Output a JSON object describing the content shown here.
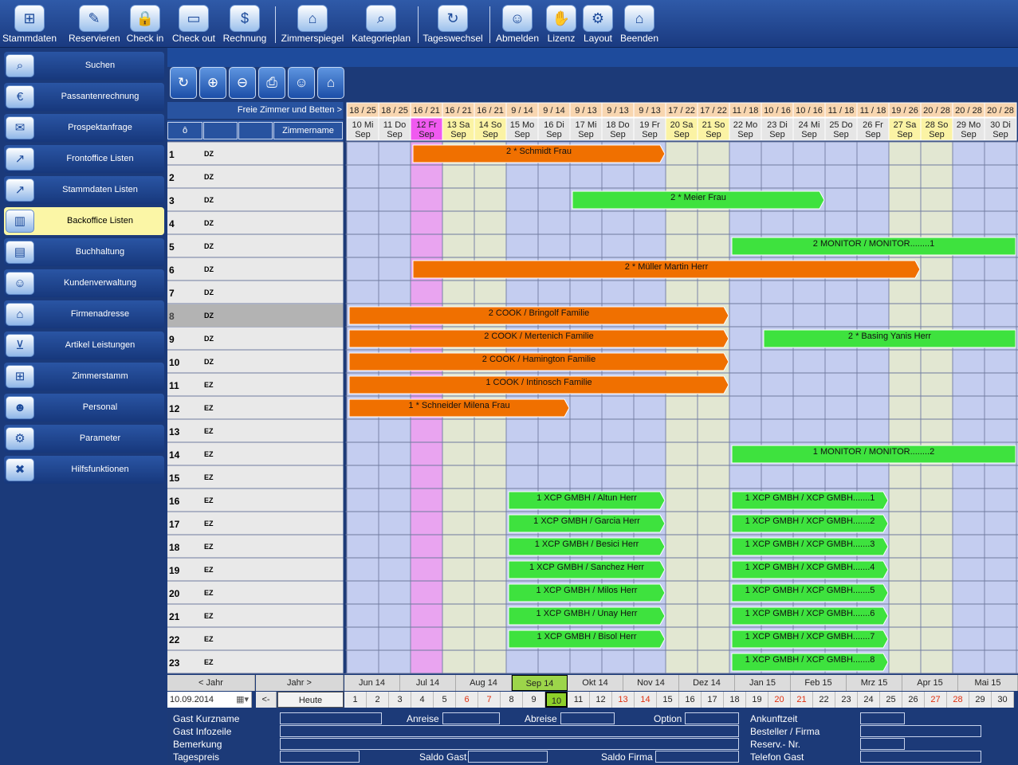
{
  "toolbar": {
    "buttons": [
      {
        "label": "Stammdaten",
        "icon": "org-chart-icon",
        "glyph": "⊞"
      },
      {
        "label": "Reservieren",
        "icon": "pen-document-icon",
        "glyph": "✎"
      },
      {
        "label": "Check in",
        "icon": "lock-icon",
        "glyph": "🔒"
      },
      {
        "label": "Check out",
        "icon": "card-icon",
        "glyph": "▭"
      },
      {
        "label": "Rechnung",
        "icon": "money-bag-icon",
        "glyph": "$"
      },
      {
        "label": "Zimmerspiegel",
        "icon": "house-icon",
        "glyph": "⌂"
      },
      {
        "label": "Kategorieplan",
        "icon": "house-search-icon",
        "glyph": "⌕"
      },
      {
        "label": "Tageswechsel",
        "icon": "refresh-icon",
        "glyph": "↻"
      },
      {
        "label": "Abmelden",
        "icon": "user-icon",
        "glyph": "☺"
      },
      {
        "label": "Lizenz",
        "icon": "handshake-icon",
        "glyph": "✋"
      },
      {
        "label": "Layout",
        "icon": "gear-icon",
        "glyph": "⚙"
      },
      {
        "label": "Beenden",
        "icon": "home-exit-icon",
        "glyph": "⌂"
      }
    ]
  },
  "sidebar": {
    "items": [
      {
        "label": "Suchen",
        "icon": "magnifier-icon",
        "glyph": "⌕"
      },
      {
        "label": "Passantenrechnung",
        "icon": "cash-icon",
        "glyph": "€"
      },
      {
        "label": "Prospektanfrage",
        "icon": "envelope-icon",
        "glyph": "✉"
      },
      {
        "label": "Frontoffice Listen",
        "icon": "line-chart-icon",
        "glyph": "↗"
      },
      {
        "label": "Stammdaten Listen",
        "icon": "line-chart-icon",
        "glyph": "↗"
      },
      {
        "label": "Backoffice Listen",
        "icon": "bar-chart-icon",
        "glyph": "▥",
        "active": true
      },
      {
        "label": "Buchhaltung",
        "icon": "books-icon",
        "glyph": "▤"
      },
      {
        "label": "Kundenverwaltung",
        "icon": "users-icon",
        "glyph": "☺"
      },
      {
        "label": "Firmenadresse",
        "icon": "bank-icon",
        "glyph": "⌂"
      },
      {
        "label": "Artikel Leistungen",
        "icon": "cart-icon",
        "glyph": "⊻"
      },
      {
        "label": "Zimmerstamm",
        "icon": "org-chart-icon",
        "glyph": "⊞"
      },
      {
        "label": "Personal",
        "icon": "person-icon",
        "glyph": "☻"
      },
      {
        "label": "Parameter",
        "icon": "gear-icon",
        "glyph": "⚙"
      },
      {
        "label": "Hilfsfunktionen",
        "icon": "tools-house-icon",
        "glyph": "✖"
      }
    ]
  },
  "tools": [
    {
      "icon": "refresh-icon",
      "glyph": "↻"
    },
    {
      "icon": "zoom-in-icon",
      "glyph": "⊕"
    },
    {
      "icon": "zoom-out-icon",
      "glyph": "⊖"
    },
    {
      "icon": "printer-icon",
      "glyph": "⎙"
    },
    {
      "icon": "users-icon",
      "glyph": "☺"
    },
    {
      "icon": "home-icon",
      "glyph": "⌂"
    }
  ],
  "grid": {
    "free_label": "Freie Zimmer und Betten >",
    "header_cols": [
      "ô",
      "",
      "",
      "Zimmername"
    ],
    "availability": [
      "18 / 25",
      "18 / 25",
      "16 / 21",
      "16 / 21",
      "16 / 21",
      "9 / 14",
      "9 / 14",
      "9 / 13",
      "9 / 13",
      "9 / 13",
      "17 / 22",
      "17 / 22",
      "11 / 18",
      "10 / 16",
      "10 / 16",
      "11 / 18",
      "11 / 18",
      "19 / 26",
      "20 / 28",
      "20 / 28",
      "20 / 28"
    ],
    "days": [
      {
        "d": "10 Mi",
        "m": "Sep",
        "kind": "normal"
      },
      {
        "d": "11 Do",
        "m": "Sep",
        "kind": "normal"
      },
      {
        "d": "12 Fr",
        "m": "Sep",
        "kind": "today"
      },
      {
        "d": "13 Sa",
        "m": "Sep",
        "kind": "weekend"
      },
      {
        "d": "14 So",
        "m": "Sep",
        "kind": "weekend"
      },
      {
        "d": "15 Mo",
        "m": "Sep",
        "kind": "normal"
      },
      {
        "d": "16 Di",
        "m": "Sep",
        "kind": "normal"
      },
      {
        "d": "17 Mi",
        "m": "Sep",
        "kind": "normal"
      },
      {
        "d": "18 Do",
        "m": "Sep",
        "kind": "normal"
      },
      {
        "d": "19 Fr",
        "m": "Sep",
        "kind": "normal"
      },
      {
        "d": "20 Sa",
        "m": "Sep",
        "kind": "weekend"
      },
      {
        "d": "21 So",
        "m": "Sep",
        "kind": "weekend"
      },
      {
        "d": "22 Mo",
        "m": "Sep",
        "kind": "normal"
      },
      {
        "d": "23 Di",
        "m": "Sep",
        "kind": "normal"
      },
      {
        "d": "24 Mi",
        "m": "Sep",
        "kind": "normal"
      },
      {
        "d": "25 Do",
        "m": "Sep",
        "kind": "normal"
      },
      {
        "d": "26 Fr",
        "m": "Sep",
        "kind": "normal"
      },
      {
        "d": "27 Sa",
        "m": "Sep",
        "kind": "weekend"
      },
      {
        "d": "28 So",
        "m": "Sep",
        "kind": "weekend"
      },
      {
        "d": "29 Mo",
        "m": "Sep",
        "kind": "normal"
      },
      {
        "d": "30 Di",
        "m": "Sep",
        "kind": "normal"
      }
    ],
    "rooms": [
      {
        "no": "1",
        "type": "DZ"
      },
      {
        "no": "2",
        "type": "DZ"
      },
      {
        "no": "3",
        "type": "DZ"
      },
      {
        "no": "4",
        "type": "DZ"
      },
      {
        "no": "5",
        "type": "DZ"
      },
      {
        "no": "6",
        "type": "DZ"
      },
      {
        "no": "7",
        "type": "DZ"
      },
      {
        "no": "8",
        "type": "DZ",
        "selected": true
      },
      {
        "no": "9",
        "type": "DZ"
      },
      {
        "no": "10",
        "type": "DZ"
      },
      {
        "no": "11",
        "type": "EZ"
      },
      {
        "no": "12",
        "type": "EZ"
      },
      {
        "no": "13",
        "type": "EZ"
      },
      {
        "no": "14",
        "type": "EZ"
      },
      {
        "no": "15",
        "type": "EZ"
      },
      {
        "no": "16",
        "type": "EZ"
      },
      {
        "no": "17",
        "type": "EZ"
      },
      {
        "no": "18",
        "type": "EZ"
      },
      {
        "no": "19",
        "type": "EZ"
      },
      {
        "no": "20",
        "type": "EZ"
      },
      {
        "no": "21",
        "type": "EZ"
      },
      {
        "no": "22",
        "type": "EZ"
      },
      {
        "no": "23",
        "type": "EZ"
      }
    ],
    "bookings": [
      {
        "room": 0,
        "start": 2,
        "end": 10,
        "label": "2 * Schmidt Frau",
        "color": "#f07000"
      },
      {
        "room": 2,
        "start": 7,
        "end": 15,
        "label": "2 * Meier Frau",
        "color": "#3ee23e"
      },
      {
        "room": 4,
        "start": 12,
        "end": 21,
        "label": "2 MONITOR / MONITOR........1",
        "color": "#3ee23e"
      },
      {
        "room": 5,
        "start": 2,
        "end": 18,
        "label": "2 * Müller Martin Herr",
        "color": "#f07000"
      },
      {
        "room": 7,
        "start": 0,
        "end": 12,
        "label": "2 COOK / Bringolf Familie",
        "color": "#f07000"
      },
      {
        "room": 8,
        "start": 0,
        "end": 12,
        "label": "2 COOK / Mertenich Familie",
        "color": "#f07000"
      },
      {
        "room": 8,
        "start": 13,
        "end": 21,
        "label": "2 * Basing Yanis Herr",
        "color": "#3ee23e"
      },
      {
        "room": 9,
        "start": 0,
        "end": 12,
        "label": "2 COOK / Hamington Familie",
        "color": "#f07000"
      },
      {
        "room": 10,
        "start": 0,
        "end": 12,
        "label": "1 COOK / Intinosch Familie",
        "color": "#f07000"
      },
      {
        "room": 11,
        "start": 0,
        "end": 7,
        "label": "1 * Schneider Milena Frau",
        "color": "#f07000"
      },
      {
        "room": 13,
        "start": 12,
        "end": 21,
        "label": "1 MONITOR / MONITOR........2",
        "color": "#3ee23e"
      },
      {
        "room": 15,
        "start": 5,
        "end": 10,
        "label": "1 XCP GMBH / Altun Herr",
        "color": "#3ee23e"
      },
      {
        "room": 15,
        "start": 12,
        "end": 17,
        "label": "1 XCP GMBH / XCP GMBH.......1",
        "color": "#3ee23e"
      },
      {
        "room": 16,
        "start": 5,
        "end": 10,
        "label": "1 XCP GMBH / Garcia Herr",
        "color": "#3ee23e"
      },
      {
        "room": 16,
        "start": 12,
        "end": 17,
        "label": "1 XCP GMBH / XCP GMBH.......2",
        "color": "#3ee23e"
      },
      {
        "room": 17,
        "start": 5,
        "end": 10,
        "label": "1 XCP GMBH / Besici Herr",
        "color": "#3ee23e"
      },
      {
        "room": 17,
        "start": 12,
        "end": 17,
        "label": "1 XCP GMBH / XCP GMBH.......3",
        "color": "#3ee23e"
      },
      {
        "room": 18,
        "start": 5,
        "end": 10,
        "label": "1 XCP GMBH / Sanchez Herr",
        "color": "#3ee23e"
      },
      {
        "room": 18,
        "start": 12,
        "end": 17,
        "label": "1 XCP GMBH / XCP GMBH.......4",
        "color": "#3ee23e"
      },
      {
        "room": 19,
        "start": 5,
        "end": 10,
        "label": "1 XCP GMBH / Milos Herr",
        "color": "#3ee23e"
      },
      {
        "room": 19,
        "start": 12,
        "end": 17,
        "label": "1 XCP GMBH / XCP GMBH.......5",
        "color": "#3ee23e"
      },
      {
        "room": 20,
        "start": 5,
        "end": 10,
        "label": "1 XCP GMBH / Unay Herr",
        "color": "#3ee23e"
      },
      {
        "room": 20,
        "start": 12,
        "end": 17,
        "label": "1 XCP GMBH / XCP GMBH.......6",
        "color": "#3ee23e"
      },
      {
        "room": 21,
        "start": 5,
        "end": 10,
        "label": "1 XCP GMBH / Bisol Herr",
        "color": "#3ee23e"
      },
      {
        "room": 21,
        "start": 12,
        "end": 17,
        "label": "1 XCP GMBH / XCP GMBH.......7",
        "color": "#3ee23e"
      },
      {
        "room": 22,
        "start": 12,
        "end": 17,
        "label": "1 XCP GMBH / XCP GMBH.......8",
        "color": "#3ee23e"
      }
    ]
  },
  "nav": {
    "prev_year": "< Jahr",
    "next_year": "Jahr >",
    "months": [
      "Jun 14",
      "Jul 14",
      "Aug 14",
      "Sep 14",
      "Okt 14",
      "Nov 14",
      "Dez 14",
      "Jan 15",
      "Feb 15",
      "Mrz 15",
      "Apr 15",
      "Mai 15"
    ],
    "selected_month": 3,
    "date_value": "10.09.2014",
    "back_label": "<-",
    "today_label": "Heute",
    "days": [
      "1",
      "2",
      "3",
      "4",
      "5",
      "6",
      "7",
      "8",
      "9",
      "10",
      "11",
      "12",
      "13",
      "14",
      "15",
      "16",
      "17",
      "18",
      "19",
      "20",
      "21",
      "22",
      "23",
      "24",
      "25",
      "26",
      "27",
      "28",
      "29",
      "30"
    ],
    "red_days": [
      5,
      6,
      12,
      13,
      19,
      20,
      26,
      27
    ],
    "selected_day": 9
  },
  "form": {
    "gast_kurzname": "Gast Kurzname",
    "gast_infozeile": "Gast Infozeile",
    "bemerkung": "Bemerkung",
    "tagespreis": "Tagespreis",
    "anreise": "Anreise",
    "abreise": "Abreise",
    "option": "Option",
    "saldo_gast": "Saldo Gast",
    "saldo_firma": "Saldo  Firma",
    "ankunftzeit": "Ankunftzeit",
    "besteller_firma": "Besteller /  Firma",
    "reserv_nr": "Reserv.- Nr.",
    "telefon_gast": "Telefon Gast"
  },
  "colors": {
    "background": "#1c3a78",
    "grid_blue": "#c4cdf0",
    "grid_weekend": "#e2e7d2",
    "today_col": "#e9a4f0",
    "booking_orange": "#f07000",
    "booking_green": "#3ee23e",
    "selected_row": "#b3b3b3"
  }
}
